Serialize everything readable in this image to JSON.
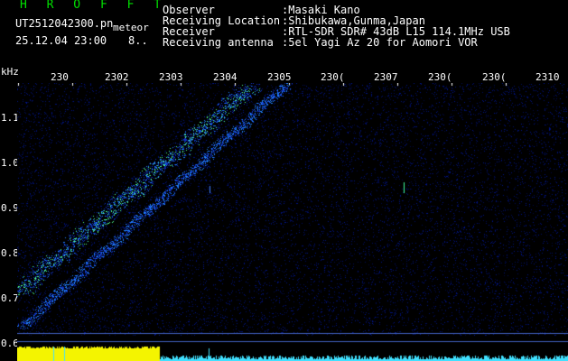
{
  "header": {
    "title": "H R O F F T",
    "filename": "UT2512042300.pn",
    "tag": "meteor",
    "datetime": "25.12.04 23:00",
    "count": "8.."
  },
  "info": {
    "rows": [
      {
        "label": "Observer",
        "value": ":Masaki Kano"
      },
      {
        "label": "Receiving Location",
        "value": ":Shibukawa,Gunma,Japan"
      },
      {
        "label": "Receiver",
        "value": ":RTL-SDR SDR# 43dB L15 114.1MHz USB"
      },
      {
        "label": "Receiving antenna",
        "value": ":5el Yagi Az 20 for Aomori VOR"
      }
    ]
  },
  "axes": {
    "y_unit": "kHz",
    "y_ticks": [
      "1.1",
      "1.0",
      "0.9",
      "0.8",
      "0.7",
      "0.6"
    ],
    "x_ticks": [
      "230",
      "2302",
      "2303",
      "2304",
      "2305",
      "230(",
      "2307",
      "230(",
      "230(",
      "2310"
    ]
  },
  "colors": {
    "background": "#000000",
    "text_green": "#00e000",
    "text_white": "#ffffff",
    "meteor_trace": "#40ffa0",
    "noise_blue": "#0a1670",
    "bottom_bar_yellow": "#f4f400",
    "bottom_bar_cyan": "#40e0ff"
  }
}
